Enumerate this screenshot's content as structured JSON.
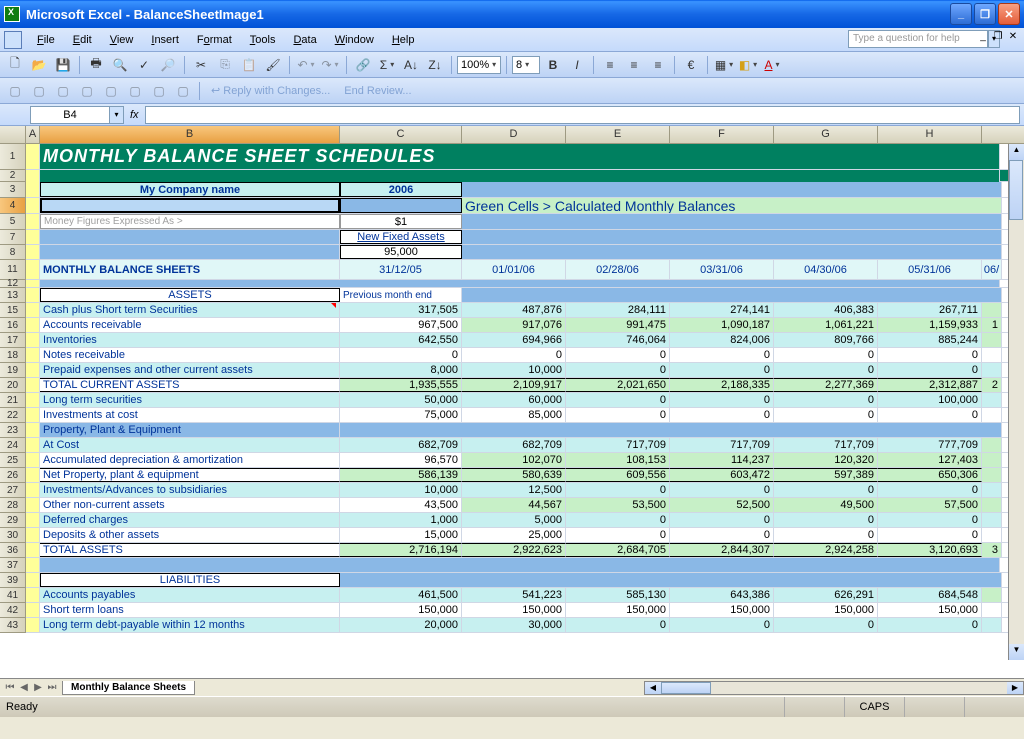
{
  "titlebar": {
    "text": "Microsoft Excel - BalanceSheetImage1"
  },
  "menu": {
    "items": [
      "File",
      "Edit",
      "View",
      "Insert",
      "Format",
      "Tools",
      "Data",
      "Window",
      "Help"
    ],
    "help_placeholder": "Type a question for help"
  },
  "toolbar": {
    "zoom": "100%",
    "fontsize": "8",
    "reply": "Reply with Changes...",
    "endreview": "End Review..."
  },
  "formula": {
    "cell_ref": "B4",
    "fx": "fx"
  },
  "columns": [
    "A",
    "B",
    "C",
    "D",
    "E",
    "F",
    "G",
    "H"
  ],
  "rows_visible": [
    "1",
    "2",
    "3",
    "4",
    "5",
    "7",
    "8",
    "11",
    "12",
    "13",
    "15",
    "16",
    "17",
    "18",
    "19",
    "20",
    "21",
    "22",
    "23",
    "24",
    "25",
    "26",
    "27",
    "28",
    "29",
    "30",
    "36",
    "37",
    "39",
    "41",
    "42",
    "43"
  ],
  "sheet": {
    "title": "MONTHLY BALANCE SHEET SCHEDULES",
    "company": "My Company name",
    "year": "2006",
    "green_note": "Green Cells > Calculated Monthly Balances",
    "money_label": "Money Figures Expressed As >",
    "money_val": "$1",
    "fixed_label": "New Fixed Assets",
    "fixed_val": "95,000",
    "section_head": "MONTHLY BALANCE SHEETS",
    "dates": [
      "31/12/05",
      "01/01/06",
      "02/28/06",
      "03/31/06",
      "04/30/06",
      "05/31/06"
    ],
    "prev_month": "Previous month end",
    "next_partial": "06/",
    "assets_header": "ASSETS",
    "liab_header": "LIABILITIES",
    "rows": {
      "cash": {
        "label": "Cash plus Short term Securities",
        "v": [
          "317,505",
          "487,876",
          "284,111",
          "274,141",
          "406,383",
          "267,711"
        ]
      },
      "ar": {
        "label": "Accounts receivable",
        "v": [
          "967,500",
          "917,076",
          "991,475",
          "1,090,187",
          "1,061,221",
          "1,159,933"
        ],
        "tail": "1"
      },
      "inv": {
        "label": "Inventories",
        "v": [
          "642,550",
          "694,966",
          "746,064",
          "824,006",
          "809,766",
          "885,244"
        ]
      },
      "notes": {
        "label": "Notes receivable",
        "v": [
          "0",
          "0",
          "0",
          "0",
          "0",
          "0"
        ]
      },
      "prep": {
        "label": "Prepaid expenses and other current assets",
        "v": [
          "8,000",
          "10,000",
          "0",
          "0",
          "0",
          "0"
        ]
      },
      "tca": {
        "label": "TOTAL CURRENT ASSETS",
        "v": [
          "1,935,555",
          "2,109,917",
          "2,021,650",
          "2,188,335",
          "2,277,369",
          "2,312,887"
        ],
        "tail": "2"
      },
      "lts": {
        "label": "Long term securities",
        "v": [
          "50,000",
          "60,000",
          "0",
          "0",
          "0",
          "100,000"
        ]
      },
      "invc": {
        "label": "Investments at cost",
        "v": [
          "75,000",
          "85,000",
          "0",
          "0",
          "0",
          "0"
        ]
      },
      "ppe_h": {
        "label": "Property, Plant & Equipment"
      },
      "cost": {
        "label": "At Cost",
        "v": [
          "682,709",
          "682,709",
          "717,709",
          "717,709",
          "717,709",
          "777,709"
        ]
      },
      "dep": {
        "label": "Accumulated depreciation & amortization",
        "v": [
          "96,570",
          "102,070",
          "108,153",
          "114,237",
          "120,320",
          "127,403"
        ]
      },
      "netppe": {
        "label": "    Net Property, plant & equipment",
        "v": [
          "586,139",
          "580,639",
          "609,556",
          "603,472",
          "597,389",
          "650,306"
        ]
      },
      "invsub": {
        "label": "Investments/Advances to subsidiaries",
        "v": [
          "10,000",
          "12,500",
          "0",
          "0",
          "0",
          "0"
        ]
      },
      "other": {
        "label": "Other non-current assets",
        "v": [
          "43,500",
          "44,567",
          "53,500",
          "52,500",
          "49,500",
          "57,500"
        ]
      },
      "defc": {
        "label": "Deferred charges",
        "v": [
          "1,000",
          "5,000",
          "0",
          "0",
          "0",
          "0"
        ]
      },
      "depo": {
        "label": "Deposits & other assets",
        "v": [
          "15,000",
          "25,000",
          "0",
          "0",
          "0",
          "0"
        ]
      },
      "ta": {
        "label": "TOTAL ASSETS",
        "v": [
          "2,716,194",
          "2,922,623",
          "2,684,705",
          "2,844,307",
          "2,924,258",
          "3,120,693"
        ],
        "tail": "3"
      },
      "ap": {
        "label": "Accounts payables",
        "v": [
          "461,500",
          "541,223",
          "585,130",
          "643,386",
          "626,291",
          "684,548"
        ]
      },
      "stl": {
        "label": "Short term loans",
        "v": [
          "150,000",
          "150,000",
          "150,000",
          "150,000",
          "150,000",
          "150,000"
        ]
      },
      "ltd": {
        "label": "Long term debt-payable within 12 months",
        "v": [
          "20,000",
          "30,000",
          "0",
          "0",
          "0",
          "0"
        ]
      }
    }
  },
  "tabs": {
    "name": "Monthly Balance Sheets"
  },
  "status": {
    "ready": "Ready",
    "caps": "CAPS"
  }
}
